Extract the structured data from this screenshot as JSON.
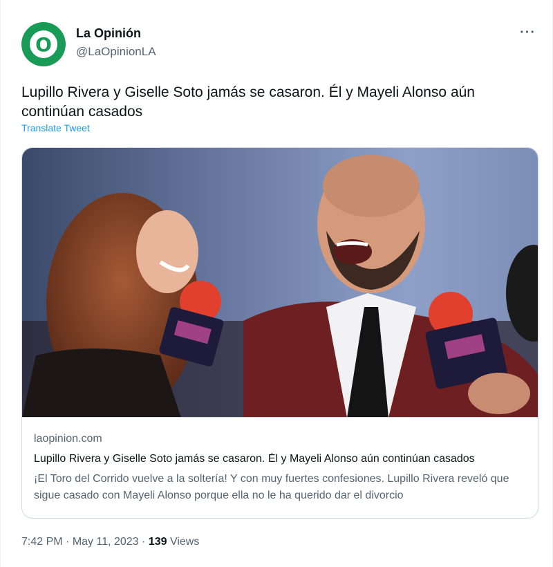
{
  "tweet": {
    "display_name": "La Opinión",
    "handle": "@LaOpinionLA",
    "avatar_letter": "O",
    "more_label": "···",
    "text": "Lupillo Rivera y Giselle Soto jamás se casaron. Él y Mayeli Alonso aún continúan casados",
    "translate_label": "Translate Tweet",
    "time": "7:42 PM",
    "separator": " · ",
    "date": "May 11, 2023",
    "views_count": "139",
    "views_label": "Views"
  },
  "card": {
    "domain": "laopinion.com",
    "title": "Lupillo Rivera y Giselle Soto jamás se casaron. Él y Mayeli Alonso aún continúan casados",
    "description": "¡El Toro del Corrido vuelve a la soltería! Y con muy fuertes confesiones. Lupillo Rivera reveló que sigue casado con Mayeli Alonso porque ella no le ha querido dar el divorcio"
  },
  "colors": {
    "avatar_bg": "#1a9a57",
    "link": "#1d9bf0",
    "secondary_text": "#536471"
  }
}
